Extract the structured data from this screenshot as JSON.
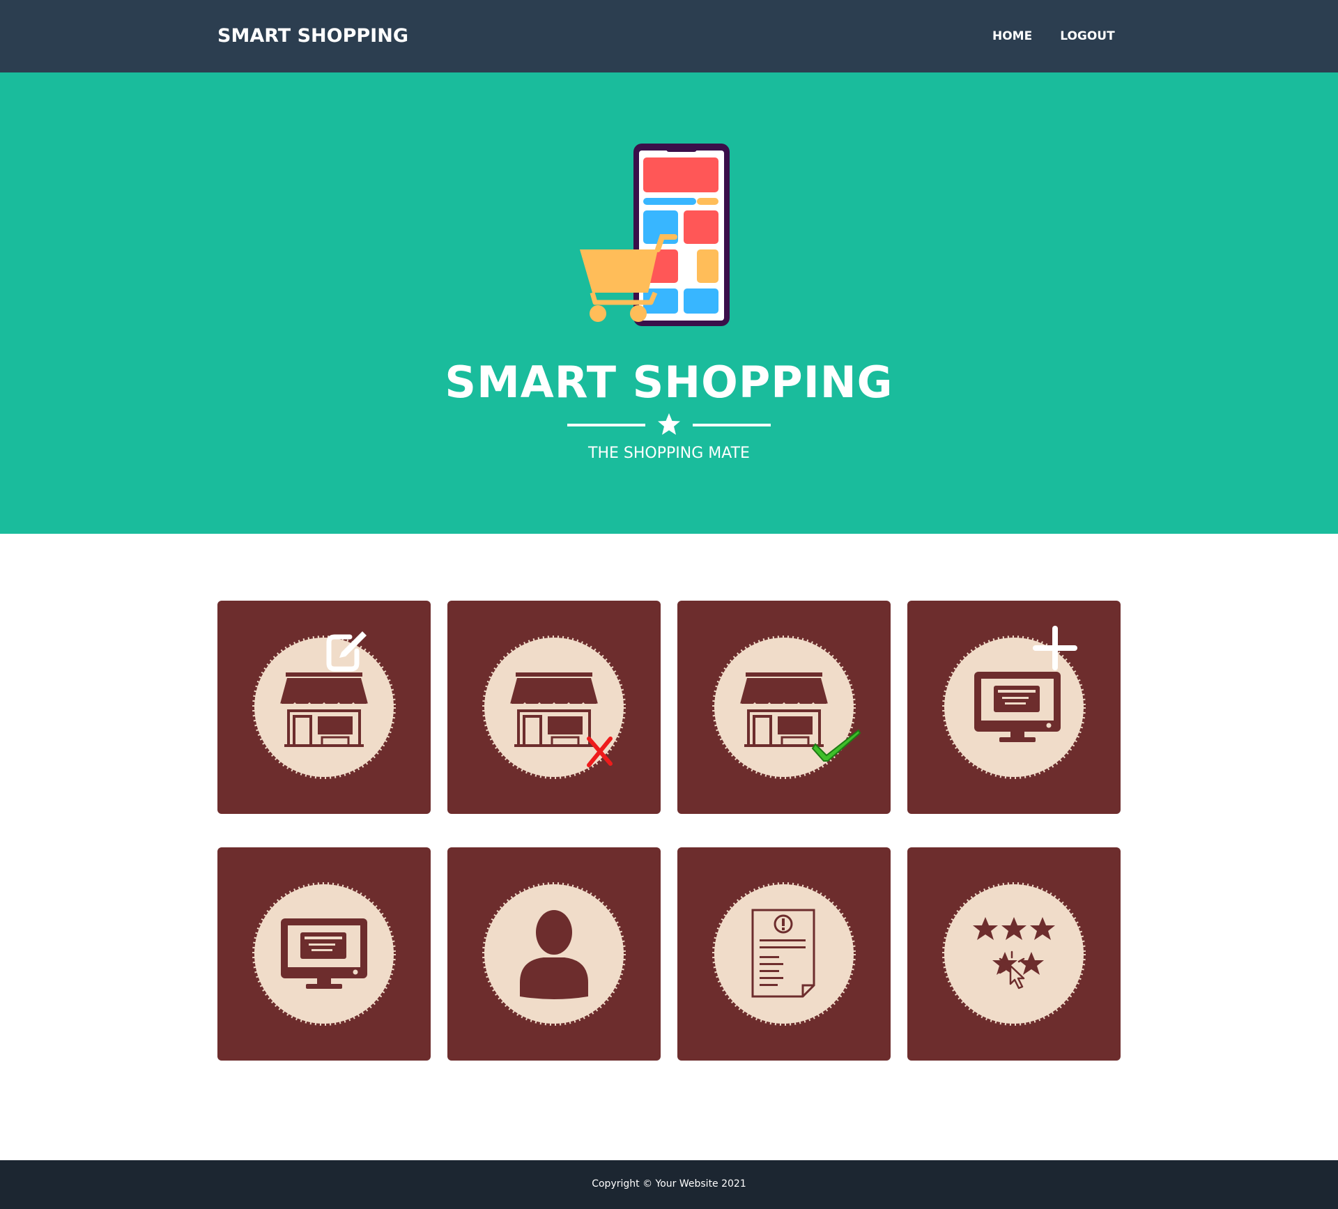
{
  "navbar": {
    "brand": "SMART SHOPPING",
    "links": [
      {
        "label": "HOME"
      },
      {
        "label": "LOGOUT"
      }
    ]
  },
  "hero": {
    "title": "SMART SHOPPING",
    "subtitle": "THE SHOPPING MATE",
    "colors": {
      "background": "#1abc9c"
    }
  },
  "tiles": [
    {
      "icon": "shop-edit-icon"
    },
    {
      "icon": "shop-remove-icon"
    },
    {
      "icon": "shop-approve-icon"
    },
    {
      "icon": "add-online-ad-icon"
    },
    {
      "icon": "online-ad-icon"
    },
    {
      "icon": "user-profile-icon"
    },
    {
      "icon": "report-document-icon"
    },
    {
      "icon": "rating-stars-icon"
    }
  ],
  "theme": {
    "navbar": "#2c3e50",
    "tile": "#6d2d2d",
    "badge": "#f0dcc9",
    "footer": "#1c2631"
  },
  "footer": {
    "copyright": "Copyright © Your Website 2021"
  }
}
